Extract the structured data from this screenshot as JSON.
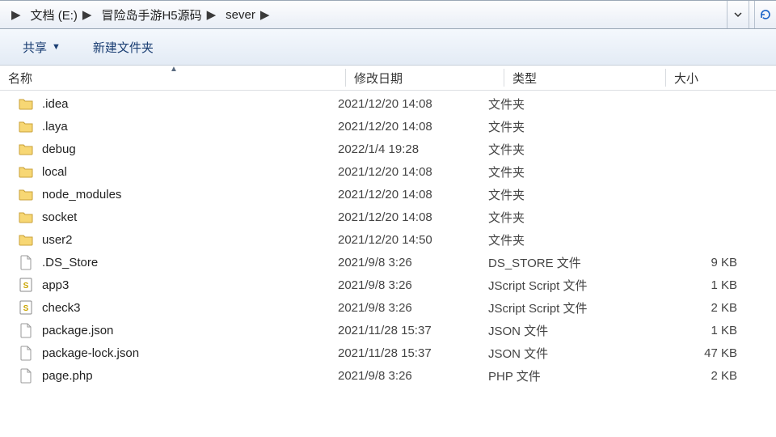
{
  "breadcrumbs": [
    "文档 (E:)",
    "冒险岛手游H5源码",
    "sever"
  ],
  "toolbar": {
    "share_label": "共享",
    "newfolder_label": "新建文件夹"
  },
  "columns": {
    "name": "名称",
    "date": "修改日期",
    "type": "类型",
    "size": "大小"
  },
  "rows": [
    {
      "icon": "folder",
      "name": ".idea",
      "date": "2021/12/20 14:08",
      "type": "文件夹",
      "size": ""
    },
    {
      "icon": "folder",
      "name": ".laya",
      "date": "2021/12/20 14:08",
      "type": "文件夹",
      "size": ""
    },
    {
      "icon": "folder",
      "name": "debug",
      "date": "2022/1/4 19:28",
      "type": "文件夹",
      "size": ""
    },
    {
      "icon": "folder",
      "name": "local",
      "date": "2021/12/20 14:08",
      "type": "文件夹",
      "size": ""
    },
    {
      "icon": "folder",
      "name": "node_modules",
      "date": "2021/12/20 14:08",
      "type": "文件夹",
      "size": ""
    },
    {
      "icon": "folder",
      "name": "socket",
      "date": "2021/12/20 14:08",
      "type": "文件夹",
      "size": ""
    },
    {
      "icon": "folder",
      "name": "user2",
      "date": "2021/12/20 14:50",
      "type": "文件夹",
      "size": ""
    },
    {
      "icon": "file",
      "name": ".DS_Store",
      "date": "2021/9/8 3:26",
      "type": "DS_STORE 文件",
      "size": "9 KB"
    },
    {
      "icon": "js",
      "name": "app3",
      "date": "2021/9/8 3:26",
      "type": "JScript Script 文件",
      "size": "1 KB"
    },
    {
      "icon": "js",
      "name": "check3",
      "date": "2021/9/8 3:26",
      "type": "JScript Script 文件",
      "size": "2 KB"
    },
    {
      "icon": "file",
      "name": "package.json",
      "date": "2021/11/28 15:37",
      "type": "JSON 文件",
      "size": "1 KB"
    },
    {
      "icon": "file",
      "name": "package-lock.json",
      "date": "2021/11/28 15:37",
      "type": "JSON 文件",
      "size": "47 KB"
    },
    {
      "icon": "file",
      "name": "page.php",
      "date": "2021/9/8 3:26",
      "type": "PHP 文件",
      "size": "2 KB"
    }
  ]
}
